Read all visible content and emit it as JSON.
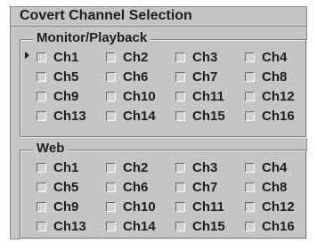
{
  "window": {
    "title": "Covert Channel Selection"
  },
  "groups": [
    {
      "legend": "Monitor/Playback",
      "channels": [
        "Ch1",
        "Ch2",
        "Ch3",
        "Ch4",
        "Ch5",
        "Ch6",
        "Ch7",
        "Ch8",
        "Ch9",
        "Ch10",
        "Ch11",
        "Ch12",
        "Ch13",
        "Ch14",
        "Ch15",
        "Ch16"
      ]
    },
    {
      "legend": "Web",
      "channels": [
        "Ch1",
        "Ch2",
        "Ch3",
        "Ch4",
        "Ch5",
        "Ch6",
        "Ch7",
        "Ch8",
        "Ch9",
        "Ch10",
        "Ch11",
        "Ch12",
        "Ch13",
        "Ch14",
        "Ch15",
        "Ch16"
      ]
    }
  ],
  "focus": {
    "icon": "pointer-arrow-icon",
    "group": 0,
    "channel": 0
  }
}
